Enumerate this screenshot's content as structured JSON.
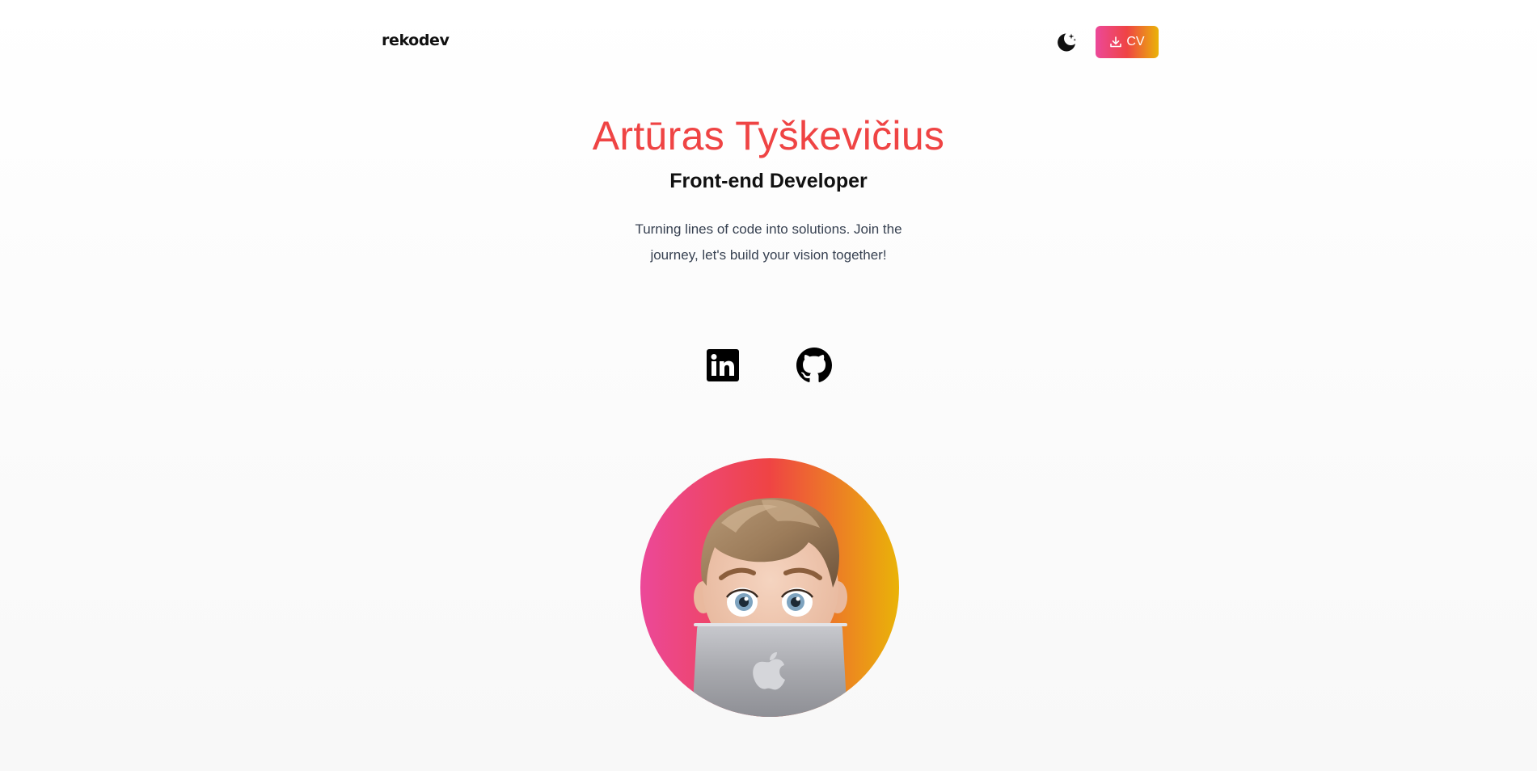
{
  "header": {
    "logo_text": "rekodev",
    "theme_toggle_icon": "moon-stars-icon",
    "cv_button": {
      "icon": "download-icon",
      "label": "CV"
    }
  },
  "hero": {
    "name": "Artūras Tyškevičius",
    "role": "Front-end Developer",
    "tagline": "Turning lines of code into solutions. Join the journey, let's build your vision together!"
  },
  "social": [
    {
      "name": "LinkedIn",
      "icon": "linkedin-icon"
    },
    {
      "name": "GitHub",
      "icon": "github-icon"
    }
  ],
  "avatar": {
    "description_icon": "memoji-avatar"
  },
  "colors": {
    "accent_red": "#ef4444",
    "gradient_pink": "#ec4899",
    "gradient_yellow": "#eab308",
    "text_dark": "#111111",
    "text_muted": "#374151"
  }
}
